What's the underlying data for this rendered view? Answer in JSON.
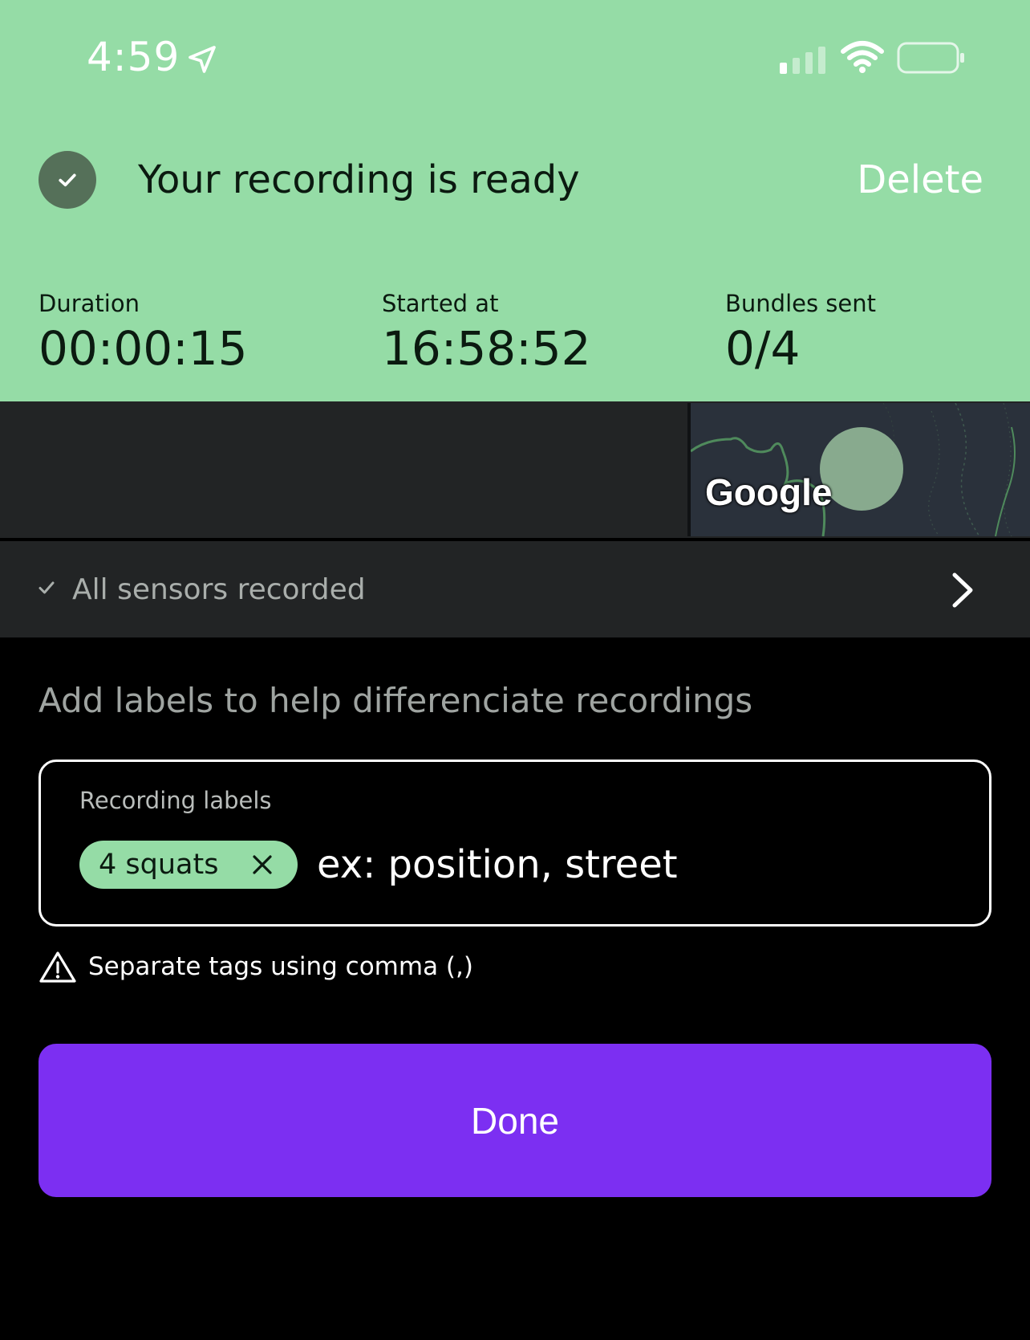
{
  "status_bar": {
    "time": "4:59",
    "icons": [
      "location-arrow-icon",
      "cellular-signal-icon",
      "wifi-icon",
      "battery-icon"
    ]
  },
  "header": {
    "title": "Your recording is ready",
    "delete_label": "Delete",
    "icon": "check-circle-icon",
    "background_color": "#95dca6"
  },
  "stats": [
    {
      "label": "Duration",
      "value": "00:00:15"
    },
    {
      "label": "Started at",
      "value": "16:58:52"
    },
    {
      "label": "Bundles sent",
      "value": "0/4"
    }
  ],
  "map": {
    "attribution": "Google"
  },
  "sensors": {
    "label": "All sensors recorded",
    "icons": [
      "check-icon",
      "chevron-right-icon"
    ]
  },
  "labels_section": {
    "hint": "Add labels to help differenciate recordings",
    "field_title": "Recording labels",
    "chips": [
      {
        "label": "4 squats"
      }
    ],
    "input_value": "",
    "input_placeholder": "ex: position, street",
    "warning": "Separate tags using comma (,)"
  },
  "actions": {
    "done_label": "Done",
    "done_color": "#7c2ff2"
  }
}
